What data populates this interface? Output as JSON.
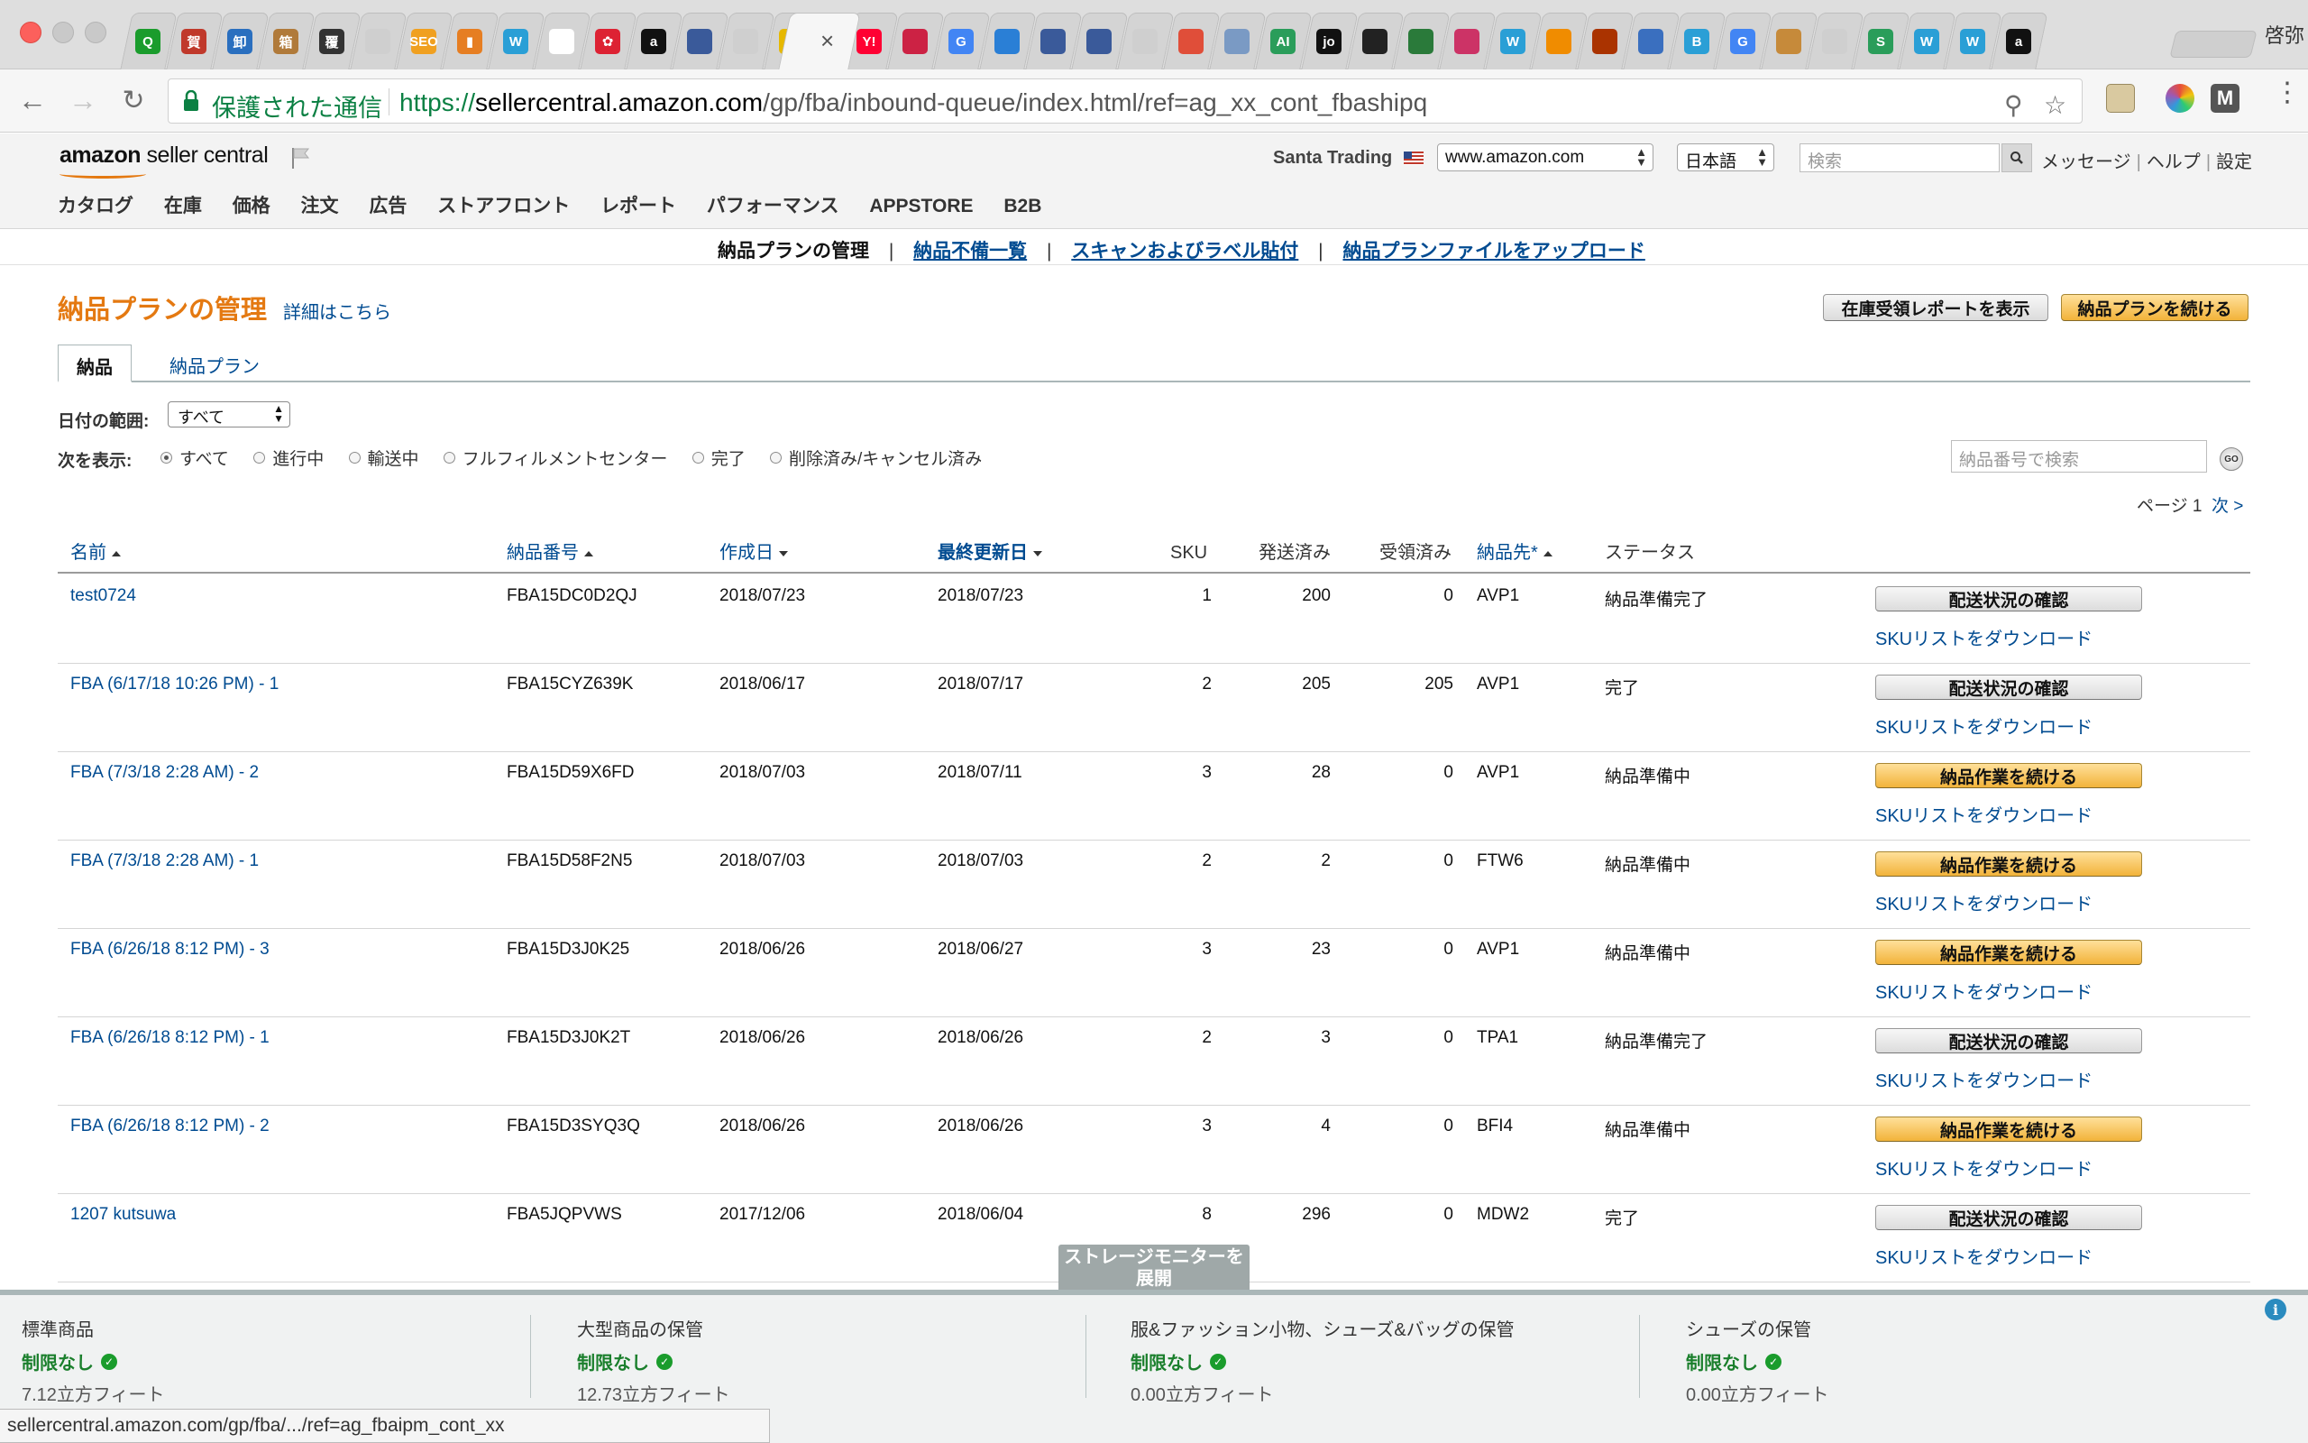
{
  "browser": {
    "active_tab_close": "×",
    "profile_name": "啓弥",
    "secure_label": "保護された通信",
    "url_scheme": "https://",
    "url_host": "sellercentral.amazon.com",
    "url_path": "/gp/fba/inbound-queue/index.html/ref=ag_xx_cont_fbashipq",
    "favicons": [
      {
        "label": "Q",
        "color": "#1a9c2c"
      },
      {
        "label": "賀",
        "color": "#c0392b"
      },
      {
        "label": "卸",
        "color": "#2a6fbf"
      },
      {
        "label": "箱",
        "color": "#b07a3a"
      },
      {
        "label": "覆",
        "color": "#333333"
      },
      {
        "label": "",
        "color": "#cfcfcf"
      },
      {
        "label": "SEO",
        "color": "#f0a020"
      },
      {
        "label": "▮",
        "color": "#e67e22"
      },
      {
        "label": "W",
        "color": "#2a9fd6"
      },
      {
        "label": "",
        "color": "#ffffff"
      },
      {
        "label": "✿",
        "color": "#d23"
      },
      {
        "label": "a",
        "color": "#111111"
      },
      {
        "label": "",
        "color": "#3a5a9a"
      },
      {
        "label": "",
        "color": "#cfcfcf"
      },
      {
        "label": "",
        "color": "#e6b800"
      },
      {
        "label": "Y!",
        "color": "#ff0033"
      },
      {
        "label": "",
        "color": "#cc2244"
      },
      {
        "label": "G",
        "color": "#4285f4"
      },
      {
        "label": "",
        "color": "#2a7fd6"
      },
      {
        "label": "",
        "color": "#3a5a9a"
      },
      {
        "label": "",
        "color": "#3a5a9a"
      },
      {
        "label": "",
        "color": "#cfcfcf"
      },
      {
        "label": "",
        "color": "#e04e39"
      },
      {
        "label": "",
        "color": "#7a9ac4"
      },
      {
        "label": "AI",
        "color": "#2a9d5a"
      },
      {
        "label": "jo",
        "color": "#111111"
      },
      {
        "label": "",
        "color": "#222222"
      },
      {
        "label": "",
        "color": "#2a7a3a"
      },
      {
        "label": "",
        "color": "#cc3366"
      },
      {
        "label": "W",
        "color": "#2a9fd6"
      },
      {
        "label": "",
        "color": "#f08c00"
      },
      {
        "label": "",
        "color": "#aa3300"
      },
      {
        "label": "",
        "color": "#3a6fbf"
      },
      {
        "label": "B",
        "color": "#2a9fd6"
      },
      {
        "label": "G",
        "color": "#4285f4"
      },
      {
        "label": "",
        "color": "#c68a3a"
      },
      {
        "label": "",
        "color": "#cfcfcf"
      },
      {
        "label": "S",
        "color": "#2a9d5a"
      },
      {
        "label": "W",
        "color": "#2a9fd6"
      },
      {
        "label": "W",
        "color": "#2a9fd6"
      },
      {
        "label": "a",
        "color": "#111111"
      }
    ]
  },
  "header": {
    "logo_bold": "amazon",
    "logo_rest": " seller central",
    "store_name": "Santa Trading",
    "marketplace": "www.amazon.com",
    "language": "日本語",
    "search_placeholder": "検索",
    "links": [
      "メッセージ",
      "ヘルプ",
      "設定"
    ],
    "nav": [
      "カタログ",
      "在庫",
      "価格",
      "注文",
      "広告",
      "ストアフロント",
      "レポート",
      "パフォーマンス",
      "APPSTORE",
      "B2B"
    ]
  },
  "subnav": {
    "current": "納品プランの管理",
    "links": [
      "納品不備一覧",
      "スキャンおよびラベル貼付",
      "納品プランファイルをアップロード"
    ]
  },
  "page": {
    "title": "納品プランの管理",
    "learn_more": "詳細はこちら",
    "btn_receipt_report": "在庫受領レポートを表示",
    "btn_continue_plan": "納品プランを続ける",
    "tab_shipments": "納品",
    "tab_plans": "納品プラン",
    "date_range_label": "日付の範囲:",
    "date_range_value": "すべて",
    "show_label": "次を表示:",
    "filters": [
      "すべて",
      "進行中",
      "輸送中",
      "フルフィルメントセンター",
      "完了",
      "削除済み/キャンセル済み"
    ],
    "search_placeholder": "納品番号で検索",
    "go_label": "GO",
    "pager_text": "ページ 1",
    "pager_next": "次 >"
  },
  "table": {
    "headers": {
      "name": "名前",
      "shipment_id": "納品番号",
      "created": "作成日",
      "updated": "最終更新日",
      "sku": "SKU",
      "shipped": "発送済み",
      "received": "受領済み",
      "destination": "納品先*",
      "status": "ステータス"
    },
    "rows": [
      {
        "name": "test0724",
        "id": "FBA15DC0D2QJ",
        "created": "2018/07/23",
        "updated": "2018/07/23",
        "sku": "1",
        "shipped": "200",
        "received": "0",
        "dest": "AVP1",
        "status": "納品準備完了",
        "action": "配送状況の確認",
        "action_style": "gray",
        "sku_link": "SKUリストをダウンロード"
      },
      {
        "name": "FBA (6/17/18 10:26 PM) - 1",
        "id": "FBA15CYZ639K",
        "created": "2018/06/17",
        "updated": "2018/07/17",
        "sku": "2",
        "shipped": "205",
        "received": "205",
        "dest": "AVP1",
        "status": "完了",
        "action": "配送状況の確認",
        "action_style": "gray",
        "sku_link": "SKUリストをダウンロード"
      },
      {
        "name": "FBA (7/3/18 2:28 AM) - 2",
        "id": "FBA15D59X6FD",
        "created": "2018/07/03",
        "updated": "2018/07/11",
        "sku": "3",
        "shipped": "28",
        "received": "0",
        "dest": "AVP1",
        "status": "納品準備中",
        "action": "納品作業を続ける",
        "action_style": "gold",
        "sku_link": "SKUリストをダウンロード"
      },
      {
        "name": "FBA (7/3/18 2:28 AM) - 1",
        "id": "FBA15D58F2N5",
        "created": "2018/07/03",
        "updated": "2018/07/03",
        "sku": "2",
        "shipped": "2",
        "received": "0",
        "dest": "FTW6",
        "status": "納品準備中",
        "action": "納品作業を続ける",
        "action_style": "gold",
        "sku_link": "SKUリストをダウンロード"
      },
      {
        "name": "FBA (6/26/18 8:12 PM) - 3",
        "id": "FBA15D3J0K25",
        "created": "2018/06/26",
        "updated": "2018/06/27",
        "sku": "3",
        "shipped": "23",
        "received": "0",
        "dest": "AVP1",
        "status": "納品準備中",
        "action": "納品作業を続ける",
        "action_style": "gold",
        "sku_link": "SKUリストをダウンロード"
      },
      {
        "name": "FBA (6/26/18 8:12 PM) - 1",
        "id": "FBA15D3J0K2T",
        "created": "2018/06/26",
        "updated": "2018/06/26",
        "sku": "2",
        "shipped": "3",
        "received": "0",
        "dest": "TPA1",
        "status": "納品準備完了",
        "action": "配送状況の確認",
        "action_style": "gray",
        "sku_link": "SKUリストをダウンロード"
      },
      {
        "name": "FBA (6/26/18 8:12 PM) - 2",
        "id": "FBA15D3SYQ3Q",
        "created": "2018/06/26",
        "updated": "2018/06/26",
        "sku": "3",
        "shipped": "4",
        "received": "0",
        "dest": "BFI4",
        "status": "納品準備中",
        "action": "納品作業を続ける",
        "action_style": "gold",
        "sku_link": "SKUリストをダウンロード"
      },
      {
        "name": "1207 kutsuwa",
        "id": "FBA5JQPVWS",
        "created": "2017/12/06",
        "updated": "2018/06/04",
        "sku": "8",
        "shipped": "296",
        "received": "0",
        "dest": "MDW2",
        "status": "完了",
        "action": "配送状況の確認",
        "action_style": "gray",
        "sku_link": "SKUリストをダウンロード"
      }
    ]
  },
  "storage": {
    "toggle_line1": "ストレージモニターを",
    "toggle_line2": "展開",
    "columns": [
      {
        "title": "標準商品",
        "status": "制限なし",
        "volume": "7.12立方フィート"
      },
      {
        "title": "大型商品の保管",
        "status": "制限なし",
        "volume": "12.73立方フィート"
      },
      {
        "title": "服&ファッション小物、シューズ&バッグの保管",
        "status": "制限なし",
        "volume": "0.00立方フィート"
      },
      {
        "title": "シューズの保管",
        "status": "制限なし",
        "volume": "0.00立方フィート"
      }
    ]
  },
  "status_bar": "sellercentral.amazon.com/gp/fba/.../ref=ag_fbaipm_cont_xx"
}
